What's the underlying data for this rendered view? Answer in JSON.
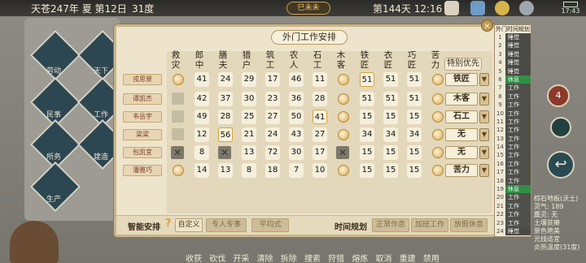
{
  "topbar": {
    "date": "天苍247年 夏 第12日",
    "temperature": "31度",
    "season_tag": "巳未未",
    "day_time": "第144天 12:16",
    "battery_time": "17:43"
  },
  "dialog": {
    "title": "外门工作安排",
    "close": "×",
    "special_header": "特别优先",
    "columns": [
      "救灾",
      "郎中",
      "膳夫",
      "猎户",
      "筑工",
      "农人",
      "石工",
      "木客",
      "铁匠",
      "衣匠",
      "巧匠",
      "苦力"
    ],
    "rows": [
      {
        "name": "戎思景",
        "cells": [
          "c",
          "41",
          "24",
          "29",
          "17",
          "46",
          "11",
          "c",
          "51h",
          "51",
          "51",
          "c"
        ],
        "special": "铁匠"
      },
      {
        "name": "谭凯杰",
        "cells": [
          "s",
          "42",
          "37",
          "30",
          "23",
          "36",
          "28",
          "c",
          "51",
          "51",
          "51",
          "c"
        ],
        "special": "木客"
      },
      {
        "name": "韦岳宇",
        "cells": [
          "s",
          "49",
          "28",
          "25",
          "27",
          "50",
          "41h",
          "c",
          "15",
          "15",
          "15",
          "c"
        ],
        "special": "石工"
      },
      {
        "name": "梁梁",
        "cells": [
          "s",
          "12",
          "56h",
          "21",
          "24",
          "43",
          "27",
          "c",
          "34",
          "34",
          "34",
          "c"
        ],
        "special": "无"
      },
      {
        "name": "包凯宜",
        "cells": [
          "x",
          "8",
          "x",
          "13",
          "72",
          "30",
          "17",
          "x",
          "15",
          "15",
          "15",
          "c"
        ],
        "special": "无"
      },
      {
        "name": "潘雅巧",
        "cells": [
          "c",
          "14",
          "13",
          "8",
          "18",
          "7",
          "10",
          "c",
          "15",
          "15",
          "15",
          "c"
        ],
        "special": "苦力"
      }
    ],
    "bottom": {
      "smart_label": "智能安排",
      "help": "?",
      "custom": "自定义",
      "expert": "专人专事",
      "equal": "平均式",
      "time_label": "时间规划",
      "normal": "正常作息",
      "overtime": "加班工作",
      "rest": "放假休息"
    }
  },
  "schedule": {
    "title": "外门时间规划",
    "rows": [
      {
        "n": "1",
        "v": "睡觉",
        "t": "sleep"
      },
      {
        "n": "2",
        "v": "睡觉",
        "t": "sleep"
      },
      {
        "n": "3",
        "v": "睡觉",
        "t": "sleep"
      },
      {
        "n": "4",
        "v": "睡觉",
        "t": "sleep"
      },
      {
        "n": "5",
        "v": "睡觉",
        "t": "sleep"
      },
      {
        "n": "6",
        "v": "休息",
        "t": "rest"
      },
      {
        "n": "7",
        "v": "工作",
        "t": "work"
      },
      {
        "n": "8",
        "v": "工作",
        "t": "work"
      },
      {
        "n": "9",
        "v": "工作",
        "t": "work"
      },
      {
        "n": "10",
        "v": "工作",
        "t": "work"
      },
      {
        "n": "11",
        "v": "工作",
        "t": "work"
      },
      {
        "n": "12",
        "v": "工作",
        "t": "work"
      },
      {
        "n": "13",
        "v": "工作",
        "t": "work"
      },
      {
        "n": "14",
        "v": "工作",
        "t": "work"
      },
      {
        "n": "15",
        "v": "工作",
        "t": "work"
      },
      {
        "n": "16",
        "v": "工作",
        "t": "work"
      },
      {
        "n": "17",
        "v": "工作",
        "t": "work"
      },
      {
        "n": "18",
        "v": "工作",
        "t": "work"
      },
      {
        "n": "19",
        "v": "休息",
        "t": "rest"
      },
      {
        "n": "20",
        "v": "工作",
        "t": "work"
      },
      {
        "n": "21",
        "v": "工作",
        "t": "work"
      },
      {
        "n": "22",
        "v": "工作",
        "t": "work"
      },
      {
        "n": "23",
        "v": "工作",
        "t": "work"
      },
      {
        "n": "24",
        "v": "睡觉",
        "t": "sleep"
      }
    ]
  },
  "left_menu": [
    "劳动",
    "天下",
    "民事",
    "工作",
    "所务",
    "建造",
    "生产"
  ],
  "bottom_actions": [
    "收获",
    "砍伐",
    "开采",
    "清除",
    "拆除",
    "搜索",
    "狩猎",
    "熔炼",
    "取消",
    "重建",
    "禁用"
  ],
  "tile_info": {
    "line1": "棕石地板(沃土)",
    "line2": "灵气: 189",
    "line3": "麋灵: 无",
    "line4": "土壤贫瘠",
    "line5": "景色艳美",
    "line6": "光线适宜",
    "line7": "炎热温度(31度)"
  },
  "side_badge": "4",
  "colors": {
    "dialog_bg": "#eee4cc",
    "rest_green": "#2f8f45",
    "work_gray": "#4f4f4b",
    "highlight": "#d8a23c"
  }
}
